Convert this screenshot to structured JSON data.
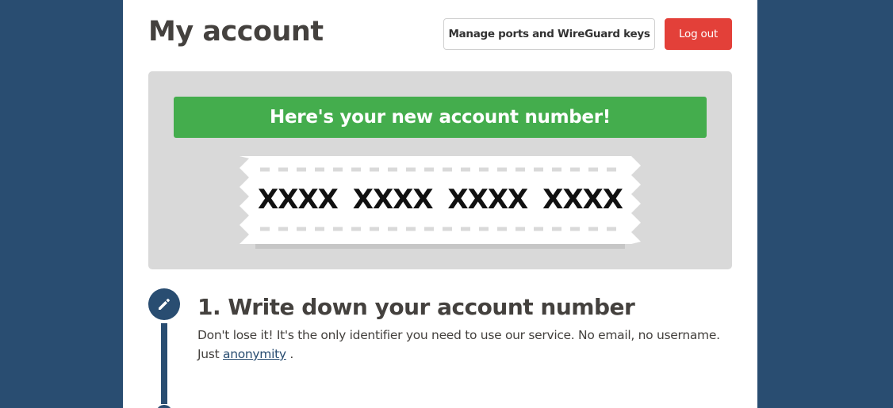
{
  "header": {
    "title": "My account",
    "manage_button": "Manage ports and WireGuard keys",
    "logout_button": "Log out"
  },
  "account_box": {
    "banner": "Here's your new account number!",
    "account_number": "XXXX XXXX XXXX XXXX"
  },
  "steps": [
    {
      "icon": "pencil-icon",
      "title": "1. Write down your account number",
      "description_before": "Don't lose it! It's the only identifier you need to use our service. No email, no username. Just",
      "link_text": "anonymity",
      "description_after": "."
    }
  ],
  "colors": {
    "background": "#294d71",
    "accent_green": "#44ad4d",
    "accent_red": "#e34039",
    "text": "#44413e",
    "panel": "#d9d9d9"
  }
}
